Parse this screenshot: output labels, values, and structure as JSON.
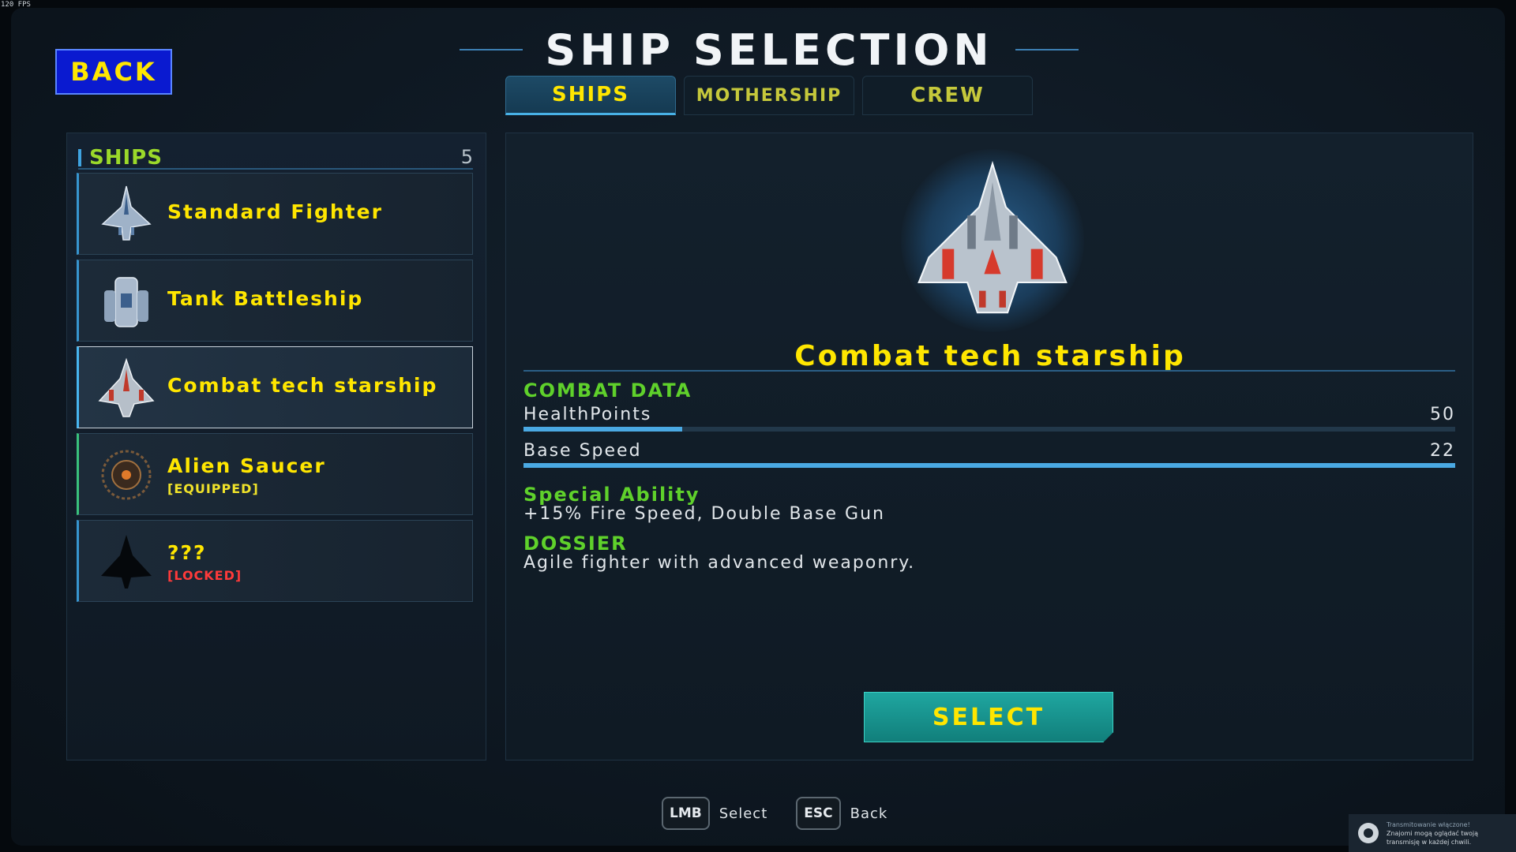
{
  "fps": "120 FPS",
  "back_button": "BACK",
  "title": "SHIP SELECTION",
  "tabs": [
    {
      "label": "SHIPS",
      "active": true
    },
    {
      "label": "MOTHERSHIP",
      "active": false
    },
    {
      "label": "CREW",
      "active": false
    }
  ],
  "ship_list": {
    "header": "SHIPS",
    "count": "5",
    "items": [
      {
        "name": "Standard Fighter",
        "status": "",
        "icon": "standard-fighter-ship-icon"
      },
      {
        "name": "Tank Battleship",
        "status": "",
        "icon": "tank-battleship-ship-icon"
      },
      {
        "name": "Combat tech starship",
        "status": "",
        "icon": "combat-tech-starship-icon",
        "selected": true
      },
      {
        "name": "Alien Saucer",
        "status": "[EQUIPPED]",
        "icon": "alien-saucer-icon"
      },
      {
        "name": "???",
        "status": "[LOCKED]",
        "icon": "locked-ship-silhouette-icon"
      }
    ]
  },
  "detail": {
    "name": "Combat tech starship",
    "combat_header": "COMBAT DATA",
    "stats": [
      {
        "label": "HealthPoints",
        "value": "50",
        "fill": 0.17
      },
      {
        "label": "Base Speed",
        "value": "22",
        "fill": 1.0
      }
    ],
    "special_header": "Special Ability",
    "special_text": "+15% Fire Speed, Double Base Gun",
    "dossier_header": "DOSSIER",
    "dossier_text": "Agile fighter with advanced weaponry.",
    "select_button": "SELECT"
  },
  "hints": [
    {
      "key": "LMB",
      "label": "Select"
    },
    {
      "key": "ESC",
      "label": "Back"
    }
  ],
  "steam_toast": {
    "line1": "Transmitowanie włączone!",
    "line2": "Znajomi mogą oglądać twoją",
    "line3": "transmisję w każdej chwili."
  },
  "colors": {
    "accent_yellow": "#ffe600",
    "accent_green": "#5fd12b",
    "accent_blue": "#4aa9e3",
    "locked_red": "#ff3a3a",
    "select_teal": "#1fa6a0",
    "back_blue": "#0a1ad0"
  }
}
